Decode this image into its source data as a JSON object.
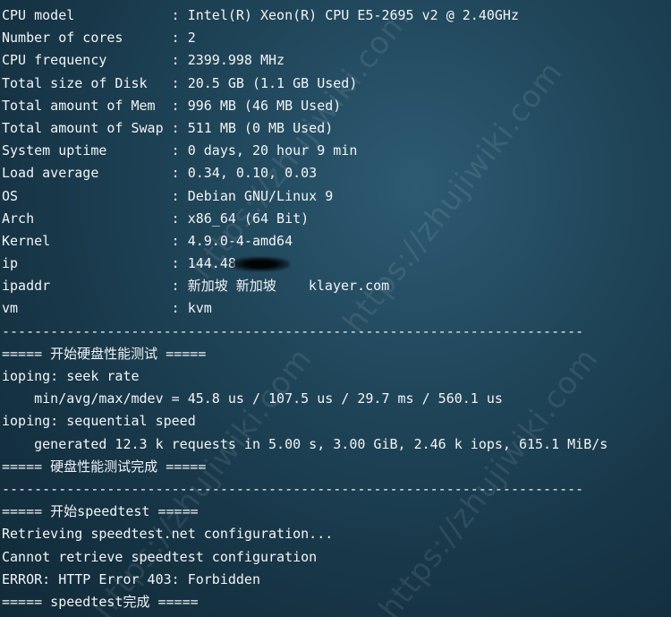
{
  "watermark_text": "https://zhujiwiki.com",
  "system_info": [
    {
      "label": "CPU model           ",
      "value": "Intel(R) Xeon(R) CPU E5-2695 v2 @ 2.40GHz"
    },
    {
      "label": "Number of cores     ",
      "value": "2"
    },
    {
      "label": "CPU frequency       ",
      "value": "2399.998 MHz"
    },
    {
      "label": "Total size of Disk  ",
      "value": "20.5 GB (1.1 GB Used)"
    },
    {
      "label": "Total amount of Mem ",
      "value": "996 MB (46 MB Used)"
    },
    {
      "label": "Total amount of Swap",
      "value": "511 MB (0 MB Used)"
    },
    {
      "label": "System uptime       ",
      "value": "0 days, 20 hour 9 min"
    },
    {
      "label": "Load average        ",
      "value": "0.34, 0.10, 0.03"
    },
    {
      "label": "OS                  ",
      "value": "Debian GNU/Linux 9"
    },
    {
      "label": "Arch                ",
      "value": "x86_64 (64 Bit)"
    },
    {
      "label": "Kernel              ",
      "value": "4.9.0-4-amd64"
    },
    {
      "label": "ip                  ",
      "value": "144.48"
    },
    {
      "label": "ipaddr              ",
      "value": "新加坡 新加坡    klayer.com"
    },
    {
      "label": "vm                  ",
      "value": "kvm"
    }
  ],
  "separator": "------------------------------------------------------------------------",
  "disk_header": "===== 开始硬盘性能测试 =====",
  "ioping_seek_label": "ioping: seek rate",
  "ioping_seek_result": "    min/avg/max/mdev = 45.8 us / 107.5 us / 29.7 ms / 560.1 us",
  "ioping_seq_label": "ioping: sequential speed",
  "ioping_seq_result": "    generated 12.3 k requests in 5.00 s, 3.00 GiB, 2.46 k iops, 615.1 MiB/s",
  "disk_footer": "===== 硬盘性能测试完成 =====",
  "speedtest_header": "===== 开始speedtest =====",
  "speedtest_retrieving": "Retrieving speedtest.net configuration...",
  "speedtest_cannot": "Cannot retrieve speedtest configuration",
  "speedtest_error": "ERROR: HTTP Error 403: Forbidden",
  "speedtest_footer": "===== speedtest完成 ====="
}
